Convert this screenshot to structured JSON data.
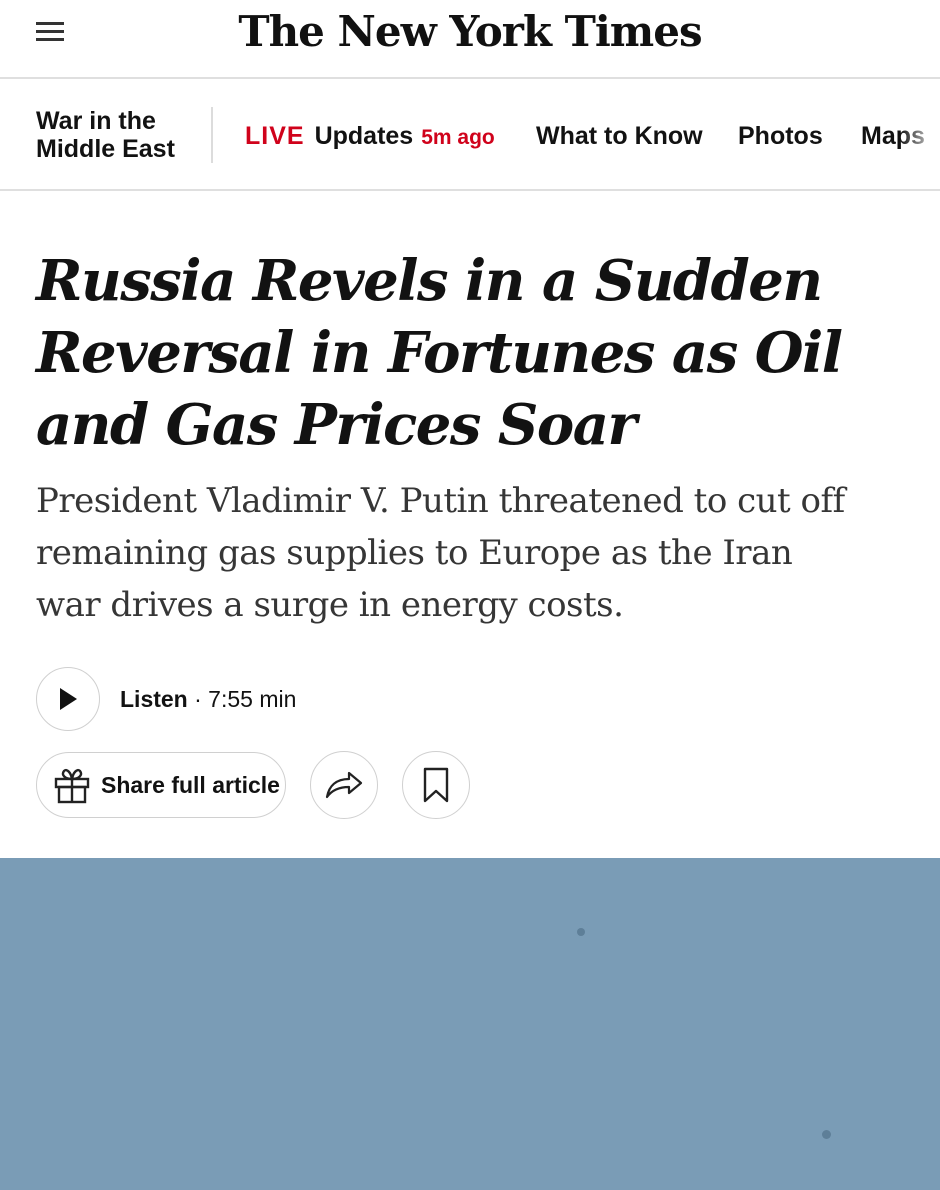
{
  "masthead": {
    "logo_text": "The New York Times",
    "menu_icon": "hamburger-menu-icon"
  },
  "subnav": {
    "section_title": "War in the Middle East",
    "live": {
      "label": "LIVE",
      "text": "Updates",
      "time": "5m ago"
    },
    "links": [
      "What to Know",
      "Photos",
      "Maps"
    ]
  },
  "article": {
    "headline": "Russia Revels in a Sudden Reversal in Fortunes as Oil and Gas Prices Soar",
    "summary": "President Vladimir V. Putin threatened to cut off remaining gas supplies to Europe as the Iran war drives a surge in energy costs."
  },
  "listen": {
    "label": "Listen",
    "duration": "· 7:55 min",
    "icon": "play-icon"
  },
  "actions": {
    "share_full_label": "Share full article",
    "gift_icon": "gift-icon",
    "share_icon": "share-arrow-icon",
    "bookmark_icon": "bookmark-icon"
  },
  "colors": {
    "live_red": "#d0021b",
    "divider": "#dfdfdf",
    "hero_sky": "#7a9cb6"
  }
}
